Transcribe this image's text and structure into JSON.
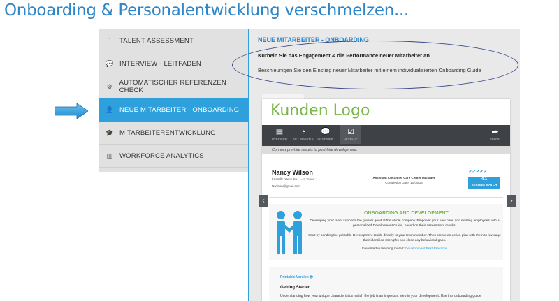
{
  "slide_title": "Onboarding & Personalentwicklung verschmelzen...",
  "colors": {
    "accent": "#2ea0dc",
    "title": "#2e86c8",
    "logo_green": "#7ab648",
    "oval": "#3b4b8c"
  },
  "sidebar": {
    "items": [
      {
        "label": "TALENT ASSESSMENT",
        "icon": "list-icon",
        "glyph": "⋮"
      },
      {
        "label": "INTERVIEW - LEITFADEN",
        "icon": "chat-icon",
        "glyph": "💬"
      },
      {
        "label": "AUTOMATISCHER REFERENZEN CHECK",
        "icon": "gears-icon",
        "glyph": "⚙"
      },
      {
        "label": "NEUE MITARBEITER - ONBOARDING",
        "icon": "user-add-icon",
        "glyph": "👤",
        "active": true
      },
      {
        "label": "MITARBEITERENTWICKLUNG",
        "icon": "graduation-cap-icon",
        "glyph": "🎓"
      },
      {
        "label": "WORKFORCE ANALYTICS",
        "icon": "bar-chart-icon",
        "glyph": "▥"
      }
    ]
  },
  "content": {
    "heading": "NEUE MITARBEITER - ONBOARDING",
    "subheading": "Kurbeln Sie das Engagement & die Performance neuer Mitarbeiter an",
    "text": "Beschleunigen Sie den Einstieg neuer Mitarbeiter mit einem individualisierten Onboarding Guide"
  },
  "preview": {
    "logo": "Kunden Logo",
    "toolbar": [
      {
        "label": "OVERVIEW",
        "icon": "document-icon",
        "glyph": "▤"
      },
      {
        "label": "KEY INSIGHTS",
        "icon": "pie-chart-icon",
        "glyph": "◔"
      },
      {
        "label": "INTERVIEW",
        "icon": "chat-icon",
        "glyph": "💬"
      },
      {
        "label": "DEVELOP",
        "icon": "checkbox-icon",
        "glyph": "☑",
        "selected": true
      },
      {
        "label": "SHARE",
        "icon": "share-icon",
        "glyph": "➦"
      }
    ],
    "tagline": "Connect pre-hire results to post-hire development.",
    "person": {
      "name": "Nancy Wilson",
      "company": "Friendly Name Co • ... > Texas •",
      "email": "Nwilson@gmail.com"
    },
    "job": {
      "title": "Assistant Customer Care Center Manager",
      "date": "Completion Date: 10/09/18"
    },
    "score": {
      "checks": "✔✔✔✔✔",
      "value": "4.1",
      "label": "STRONG MATCH"
    },
    "od": {
      "title": "ONBOARDING AND DEVELOPMENT",
      "p1": "Developing your team supports the greater good of the whole company. Empower your new hires and existing employees with a personalized Development Guide, based on their assessment results.",
      "p2": "Start by sending the printable Development Guide directly to your team member. Then create an action plan with them to leverage their identified strengths and close any behavioral gaps.",
      "p3_prefix": "Interested in learning more?:",
      "p3_link": "Development Best Practices"
    },
    "printable": {
      "link": "Printable Version 🖶",
      "heading": "Getting Started",
      "text": "Understanding how your unique characteristics match the job is an important step in your development. Use this onboarding guide"
    },
    "carousel": {
      "prev": "‹",
      "next": "›"
    }
  }
}
